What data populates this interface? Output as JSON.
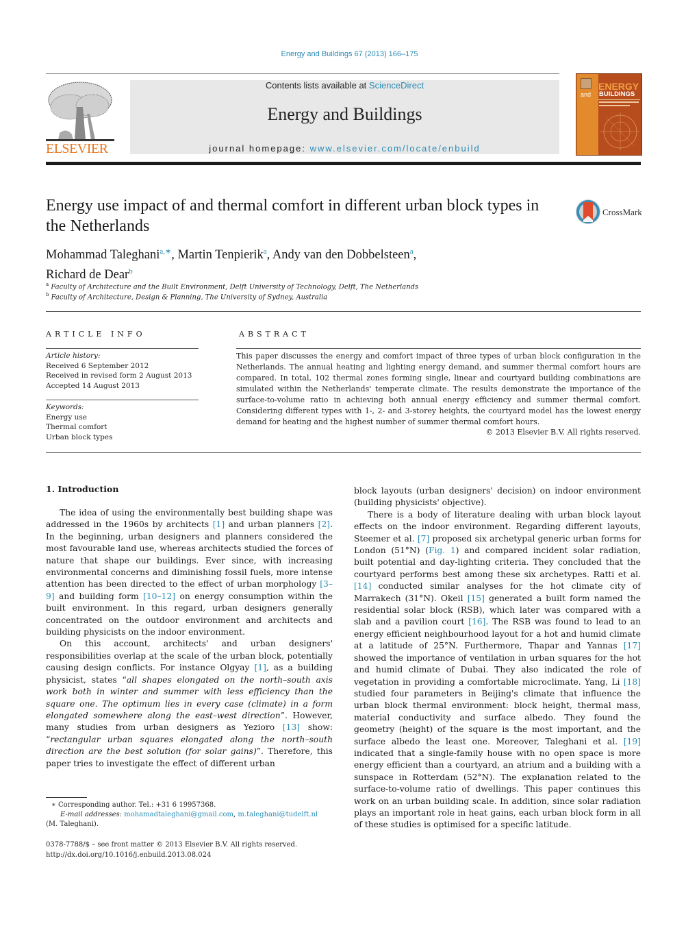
{
  "header": {
    "citation": "Energy and Buildings 67 (2013) 166–175",
    "contents_prefix": "Contents lists available at ",
    "contents_link": "ScienceDirect",
    "journal_name": "Energy and Buildings",
    "homepage_prefix": "journal homepage: ",
    "homepage_link": "www.elsevier.com/locate/enbuild",
    "publisher_logo_text": "ELSEVIER",
    "cover": {
      "title_top": "ENERGY",
      "title_and": "and",
      "title_bottom": "BUILDINGS",
      "colors": {
        "primary": "#b74c1d",
        "accent": "#e38a2c"
      }
    }
  },
  "article": {
    "title": "Energy use impact of and thermal comfort in different urban block types in the Netherlands",
    "crossmark_label": "CrossMark",
    "authors": [
      {
        "name": "Mohammad Taleghani",
        "sup": "a,∗"
      },
      {
        "name": "Martin Tenpierik",
        "sup": "a"
      },
      {
        "name": "Andy van den Dobbelsteen",
        "sup": "a"
      },
      {
        "name": "Richard de Dear",
        "sup": "b"
      }
    ],
    "affiliations": [
      {
        "mark": "a",
        "text": "Faculty of Architecture and the Built Environment, Delft University of Technology, Delft, The Netherlands"
      },
      {
        "mark": "b",
        "text": "Faculty of Architecture, Design & Planning, The University of Sydney, Australia"
      }
    ]
  },
  "article_info": {
    "heading": "ARTICLE INFO",
    "history_label": "Article history:",
    "history": [
      "Received 6 September 2012",
      "Received in revised form 2 August 2013",
      "Accepted 14 August 2013"
    ],
    "keywords_label": "Keywords:",
    "keywords": [
      "Energy use",
      "Thermal comfort",
      "Urban block types"
    ]
  },
  "abstract": {
    "heading": "ABSTRACT",
    "text": "This paper discusses the energy and comfort impact of three types of urban block configuration in the Netherlands. The annual heating and lighting energy demand, and summer thermal comfort hours are compared. In total, 102 thermal zones forming single, linear and courtyard building combinations are simulated within the Netherlands' temperate climate. The results demonstrate the importance of the surface-to-volume ratio in achieving both annual energy efficiency and summer thermal comfort. Considering different types with 1-, 2- and 3-storey heights, the courtyard model has the lowest energy demand for heating and the highest number of summer thermal comfort hours.",
    "copyright": "© 2013 Elsevier B.V. All rights reserved."
  },
  "body": {
    "section_title": "1.  Introduction",
    "left_p1": [
      "The idea of using the environmentally best building shape was addressed in the 1960s by architects ",
      "[1]",
      " and urban planners ",
      "[2]",
      ". In the beginning, urban designers and planners considered the most favourable land use, whereas architects studied the forces of nature that shape our buildings. Ever since, with increasing environmental concerns and diminishing fossil fuels, more intense attention has been directed to the effect of urban morphology ",
      "[3–9]",
      " and building form ",
      "[10–12]",
      " on energy consumption within the built environment. In this regard, urban designers generally concentrated on the outdoor environment and architects and building physicists on the indoor environment."
    ],
    "left_p2": {
      "a": "On this account, architects' and urban designers' responsibilities overlap at the scale of the urban block, potentially causing design conflicts. For instance Olgyay ",
      "ref1": "[1]",
      "b": ", as a building physicist, states “",
      "quote1": "all shapes elongated on the north–south axis work both in winter and summer with less efficiency than the square one. The optimum lies in every case (climate) in a form elongated somewhere along the east–west direction",
      "c": "”. However, many studies from urban designers as Yezioro ",
      "ref2": "[13]",
      "d": " show: “",
      "quote2": "rectangular urban squares elongated along the north–south direction are the best solution (for solar gains)",
      "e": "”. Therefore, this paper tries to investigate the effect of different urban"
    },
    "right_p0": "block layouts (urban designers' decision) on indoor environment (building physicists' objective).",
    "right_p1": [
      "There is a body of literature dealing with urban block layout effects on the indoor environment. Regarding different layouts, Steemer et al. ",
      "[7]",
      " proposed six archetypal generic urban forms for London (51°N) (",
      "Fig. 1",
      ") and compared incident solar radiation, built potential and day-lighting criteria. They concluded that the courtyard performs best among these six archetypes. Ratti et al. ",
      "[14]",
      " conducted similar analyses for the hot climate city of Marrakech (31°N). Okeil ",
      "[15]",
      " generated a built form named the residential solar block (RSB), which later was compared with a slab and a pavilion court ",
      "[16]",
      ". The RSB was found to lead to an energy efficient neighbourhood layout for a hot and humid climate at a latitude of 25°N. Furthermore, Thapar and Yannas ",
      "[17]",
      " showed the importance of ventilation in urban squares for the hot and humid climate of Dubai. They also indicated the role of vegetation in providing a comfortable microclimate. Yang, Li ",
      "[18]",
      " studied four parameters in Beijing's climate that influence the urban block thermal environment: block height, thermal mass, material conductivity and surface albedo. They found the geometry (height) of the square is the most important, and the surface albedo the least one. Moreover, Taleghani et al. ",
      "[19]",
      " indicated that a single-family house with no open space is more energy efficient than a courtyard, an atrium and a building with a sunspace in Rotterdam (52°N). The explanation related to the surface-to-volume ratio of dwellings. This paper continues this work on an urban building scale. In addition, since solar radiation plays an important role in heat gains, each urban block form in all of these studies is optimised for a specific latitude."
    ]
  },
  "footnotes": {
    "corresponding": "∗  Corresponding author. Tel.: +31 6 19957368.",
    "email_label": "E-mail addresses:",
    "email1": "mohamadtaleghani@gmail.com",
    "email2": "m.taleghani@tudelft.nl",
    "email_owner": "(M. Taleghani).",
    "issn_line": "0378-7788/$ – see front matter © 2013 Elsevier B.V. All rights reserved.",
    "doi": "http://dx.doi.org/10.1016/j.enbuild.2013.08.024"
  }
}
